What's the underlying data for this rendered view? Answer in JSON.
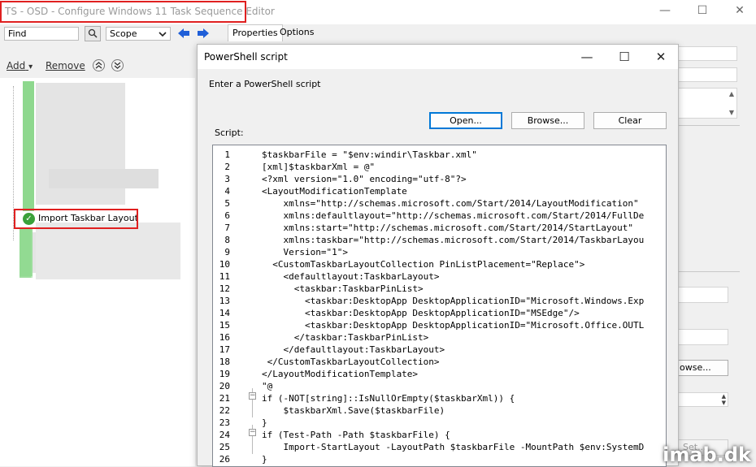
{
  "window": {
    "title": "TS - OSD - Configure Windows 11 Task Sequence Editor",
    "minimize": "—",
    "maximize": "☐",
    "close": "✕"
  },
  "toolbar": {
    "find_value": "Find",
    "scope_value": "Scope",
    "search_icon": "magnifier-icon",
    "dropdown_icon": "chevron-down-icon",
    "back_icon": "arrow-left-icon",
    "forward_icon": "arrow-right-icon"
  },
  "tabs": [
    {
      "label": "Properties"
    },
    {
      "label": "Options"
    }
  ],
  "tree": {
    "add_label": "Add",
    "add_caret": "▾",
    "remove_label": "Remove",
    "move_up_icon": "double-chevron-up-icon",
    "move_down_icon": "double-chevron-down-icon",
    "selected_item": "Import Taskbar Layout",
    "status_color": "#3aa13a"
  },
  "right_panel": {
    "browse_label": "owse...",
    "set_label": "Set..."
  },
  "dialog": {
    "title": "PowerShell script",
    "minimize": "—",
    "maximize": "☐",
    "close": "✕",
    "instruction": "Enter a PowerShell script",
    "script_label": "Script:",
    "open_label": "Open...",
    "browse_label": "Browse...",
    "clear_label": "Clear"
  },
  "script_lines": [
    "$taskbarFile = \"$env:windir\\Taskbar.xml\"",
    "[xml]$taskbarXml = @\"",
    "<?xml version=\"1.0\" encoding=\"utf-8\"?>",
    "<LayoutModificationTemplate",
    "    xmlns=\"http://schemas.microsoft.com/Start/2014/LayoutModification\"",
    "    xmlns:defaultlayout=\"http://schemas.microsoft.com/Start/2014/FullDe",
    "    xmlns:start=\"http://schemas.microsoft.com/Start/2014/StartLayout\"",
    "    xmlns:taskbar=\"http://schemas.microsoft.com/Start/2014/TaskbarLayou",
    "    Version=\"1\">",
    "  <CustomTaskbarLayoutCollection PinListPlacement=\"Replace\">",
    "    <defaultlayout:TaskbarLayout>",
    "      <taskbar:TaskbarPinList>",
    "        <taskbar:DesktopApp DesktopApplicationID=\"Microsoft.Windows.Exp",
    "        <taskbar:DesktopApp DesktopApplicationID=\"MSEdge\"/>",
    "        <taskbar:DesktopApp DesktopApplicationID=\"Microsoft.Office.OUTL",
    "      </taskbar:TaskbarPinList>",
    "    </defaultlayout:TaskbarLayout>",
    " </CustomTaskbarLayoutCollection>",
    "</LayoutModificationTemplate>",
    "\"@",
    "if (-NOT[string]::IsNullOrEmpty($taskbarXml)) {",
    "    $taskbarXml.Save($taskbarFile)",
    "}",
    "if (Test-Path -Path $taskbarFile) {",
    "    Import-StartLayout -LayoutPath $taskbarFile -MountPath $env:SystemD",
    "}"
  ],
  "watermark": "imab.dk"
}
